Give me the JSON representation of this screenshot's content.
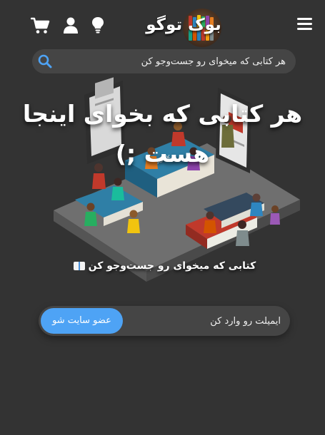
{
  "header": {
    "logo_text": "بوک توگو",
    "icons": [
      "menu-icon",
      "lightbulb-icon",
      "user-icon",
      "cart-icon"
    ]
  },
  "search": {
    "placeholder": "هر کتابی که میخوای رو جست‌وجو کن"
  },
  "hero": {
    "title": "هر کتابی که بخوای اینجا هست ;)",
    "subtitle": "کتابی که میخوای رو جست‌وجو کن",
    "illustration_book_label": "BOOK"
  },
  "subscribe": {
    "email_placeholder": "ایمیلت رو وارد کن",
    "join_label": "عضو سایت شو"
  },
  "colors": {
    "background": "#333333",
    "field": "#454545",
    "accent": "#4ea3f5",
    "text": "#ffffff"
  }
}
